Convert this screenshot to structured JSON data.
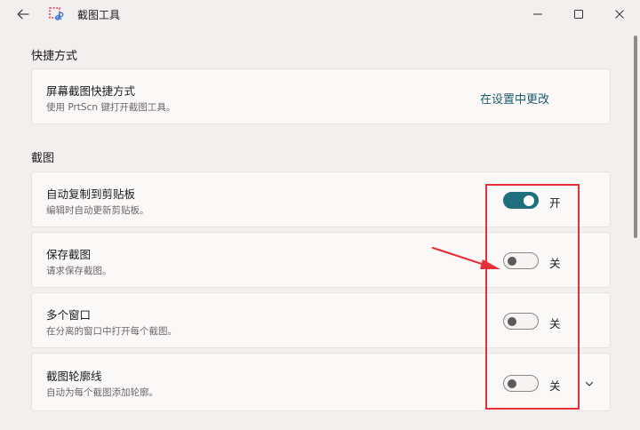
{
  "window": {
    "title": "截图工具",
    "back_icon": "back-arrow-icon",
    "app_icon": "snipping-tool-icon",
    "controls": [
      "minimize-icon",
      "maximize-icon",
      "close-icon"
    ]
  },
  "sections": {
    "shortcuts": {
      "title": "快捷方式",
      "item": {
        "title": "屏幕截图快捷方式",
        "description": "使用 PrtScn 键打开截图工具。",
        "action_label": "在设置中更改"
      }
    },
    "snip": {
      "title": "截图",
      "items": [
        {
          "title": "自动复制到剪贴板",
          "description": "编辑时自动更新剪贴板。",
          "state": "开",
          "on": true
        },
        {
          "title": "保存截图",
          "description": "请求保存截图。",
          "state": "关",
          "on": false
        },
        {
          "title": "多个窗口",
          "description": "在分离的窗口中打开每个截图。",
          "state": "关",
          "on": false
        },
        {
          "title": "截图轮廓线",
          "description": "自动为每个截图添加轮廓。",
          "state": "关",
          "on": false,
          "expandable": true
        }
      ]
    }
  },
  "colors": {
    "accent": "#1f6f7d",
    "annotation": "#e5303a",
    "background": "#f3efee"
  }
}
